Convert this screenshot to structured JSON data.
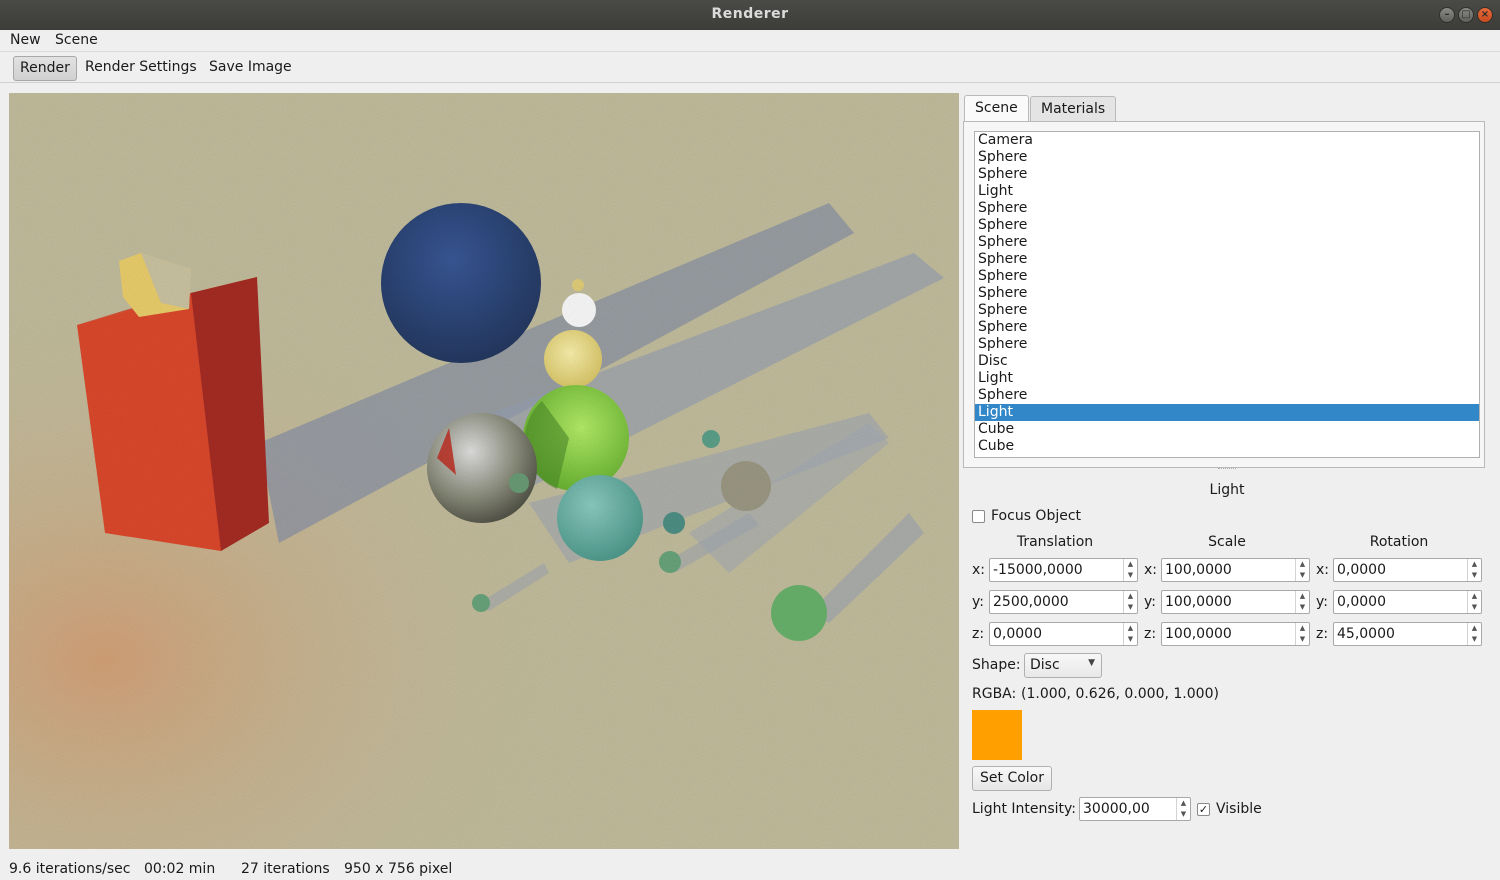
{
  "window": {
    "title": "Renderer",
    "controls": [
      "–",
      "□",
      "×"
    ]
  },
  "menu": {
    "new": "New",
    "scene": "Scene"
  },
  "toolbar": {
    "render": "Render",
    "render_settings": "Render Settings",
    "save_image": "Save Image"
  },
  "tabs": {
    "scene": "Scene",
    "materials": "Materials"
  },
  "objects": [
    "Camera",
    "Sphere",
    "Sphere",
    "Light",
    "Sphere",
    "Sphere",
    "Sphere",
    "Sphere",
    "Sphere",
    "Sphere",
    "Sphere",
    "Sphere",
    "Sphere",
    "Disc",
    "Light",
    "Sphere",
    "Light",
    "Cube",
    "Cube"
  ],
  "selected_index": 16,
  "properties": {
    "header": "Light",
    "focus_label": "Focus Object",
    "focus_checked": false,
    "translation_label": "Translation",
    "scale_label": "Scale",
    "rotation_label": "Rotation",
    "axis_x": "x:",
    "axis_y": "y:",
    "axis_z": "z:",
    "translation": {
      "x": "-15000,0000",
      "y": "2500,0000",
      "z": "0,0000"
    },
    "scale": {
      "x": "100,0000",
      "y": "100,0000",
      "z": "100,0000"
    },
    "rotation": {
      "x": "0,0000",
      "y": "0,0000",
      "z": "45,0000"
    },
    "shape_label": "Shape:",
    "shape_value": "Disc",
    "rgba_label": "RGBA:",
    "rgba_value": "(1.000, 0.626, 0.000, 1.000)",
    "color_hex": "#ff9f00",
    "set_color": "Set Color",
    "intensity_label": "Light Intensity:",
    "intensity_value": "30000,00",
    "visible_label": "Visible",
    "visible_checked": true
  },
  "status": {
    "rate": "9.6 iterations/sec",
    "time": "00:02 min",
    "iterations": "27 iterations",
    "width": "950 x",
    "height": "756 pixel"
  },
  "colors": {
    "selection": "#3287c8",
    "titlebar": "#3c3c39"
  }
}
